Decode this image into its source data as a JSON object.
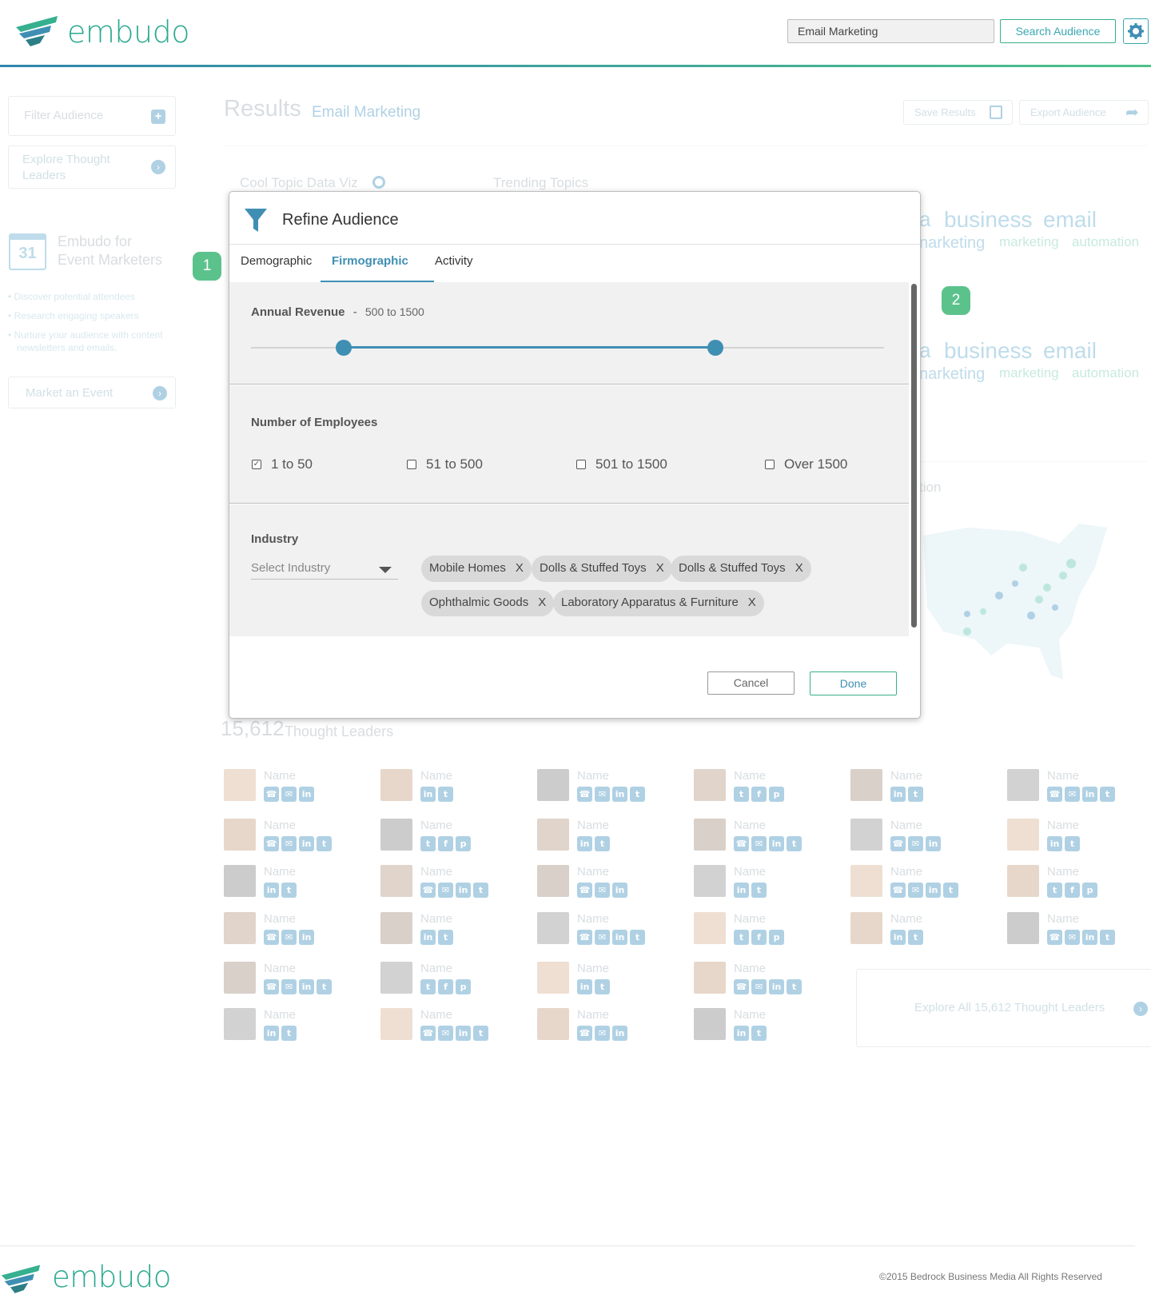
{
  "header": {
    "logo_text": "embudo",
    "search_value": "Email Marketing",
    "search_button": "Search Audience"
  },
  "sidebar": {
    "filter_audience": "Filter Audience",
    "explore_thought_leaders": "Explore Thought Leaders",
    "calendar_day": "31",
    "promo_title_line1": "Embudo for",
    "promo_title_line2": "Event Marketers",
    "bullets": [
      "• Discover potential attendees",
      "• Research engaging speakers",
      "• Nurture your audience with content",
      "newsletters and emails."
    ],
    "market_event": "Market an Event"
  },
  "results": {
    "title": "Results",
    "query": "Email Marketing",
    "save_results": "Save Results",
    "export_audience": "Export Audience",
    "cool_topic": "Cool Topic Data Viz",
    "trending_topics": "Trending Topics",
    "cloud_row1": [
      "a",
      "business",
      "email",
      "narketing",
      "marketing",
      "automation"
    ],
    "cloud_row2": [
      "a",
      "business",
      "email",
      "narketing",
      "marketing",
      "automation"
    ],
    "map_label": "tion",
    "count": "15,612",
    "count_label": "Thought Leaders",
    "tl_name": "Name",
    "explore_all": "Explore All 15,612 Thought Leaders"
  },
  "callouts": {
    "one": "1",
    "two": "2"
  },
  "modal": {
    "title": "Refine Audience",
    "tabs": [
      "Demographic",
      "Firmographic",
      "Activity"
    ],
    "active_tab": "Firmographic",
    "revenue": {
      "label": "Annual Revenue",
      "separator": "-",
      "range_text": "500 to 1500",
      "low_fraction": 0.147,
      "high_fraction": 0.733
    },
    "employees": {
      "label": "Number of Employees",
      "options": [
        {
          "label": "1 to 50",
          "checked": true
        },
        {
          "label": "51 to 500",
          "checked": false
        },
        {
          "label": "501 to 1500",
          "checked": false
        },
        {
          "label": "Over 1500",
          "checked": false
        }
      ]
    },
    "industry": {
      "label": "Industry",
      "placeholder": "Select Industry",
      "chips": [
        "Mobile Homes",
        "Dolls & Stuffed Toys",
        "Dolls & Stuffed Toys",
        "Ophthalmic Goods",
        "Laboratory Apparatus & Furniture"
      ],
      "chip_remove": "X"
    },
    "cancel": "Cancel",
    "done": "Done"
  },
  "footer": {
    "logo_text": "embudo",
    "copyright": "©2015 Bedrock Business Media All Rights Reserved"
  },
  "colors": {
    "brand_teal": "#2aa98f",
    "brand_blue": "#3f8fb3",
    "slider": "#3f8fb3",
    "callout": "#5cc28c"
  }
}
